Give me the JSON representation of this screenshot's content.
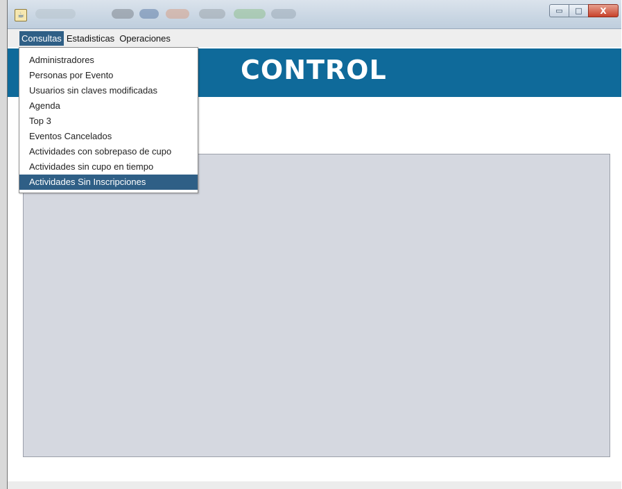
{
  "window": {
    "buttons": {
      "minimize": "▭",
      "maximize": "□",
      "close": "X"
    }
  },
  "menubar": {
    "items": [
      "Consultas",
      "Estadisticas",
      "Operaciones"
    ],
    "active": "Consultas"
  },
  "banner": {
    "title": "CONTROL"
  },
  "consultas_menu": {
    "items": [
      "Administradores",
      "Personas por Evento",
      "Usuarios sin claves modificadas",
      "Agenda",
      "Top 3",
      "Eventos Cancelados",
      "Actividades con sobrepaso de cupo",
      "Actividades sin cupo en tiempo",
      "Actividades Sin Inscripciones"
    ],
    "highlighted": "Actividades Sin Inscripciones"
  },
  "colors": {
    "banner": "#0f6a9a",
    "menu_highlight": "#2f5f86",
    "panel": "#d5d8e0"
  },
  "icons": {
    "app": "java-app-icon"
  }
}
